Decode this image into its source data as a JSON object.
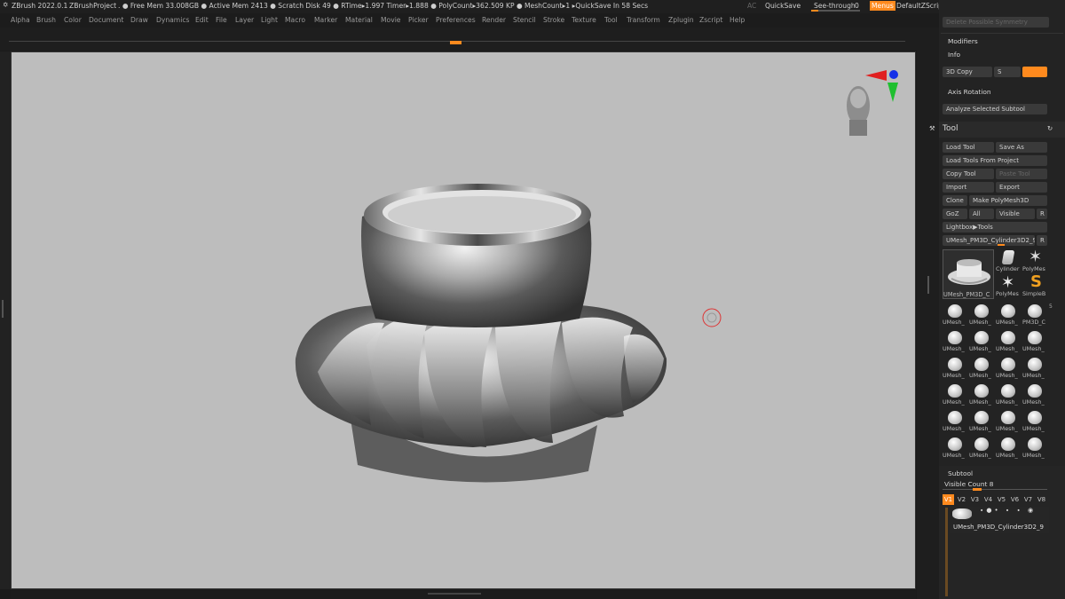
{
  "titlebar": {
    "app": "ZBrush 2022.0.1",
    "project": "ZBrushProject",
    "status": ". ● Free Mem 33.008GB ● Active Mem 2413 ● Scratch Disk 49 ●  RTime▸1.997 Timer▸1.888 ● PolyCount▸362.509 KP  ● MeshCount▸1  ▸QuickSave In 58 Secs",
    "ac": "AC",
    "quicksave": "QuickSave",
    "seethrough": "See-through",
    "seethrough_value": "0",
    "menus": "Menus",
    "script": "DefaultZScript"
  },
  "menubar": [
    "Alpha",
    "Brush",
    "Color",
    "Document",
    "Draw",
    "Dynamics",
    "Edit",
    "File",
    "Layer",
    "Light",
    "Macro",
    "Marker",
    "Material",
    "Movie",
    "Picker",
    "Preferences",
    "Render",
    "Stencil",
    "Stroke",
    "Texture",
    "Tool",
    "Transform",
    "Zplugin",
    "Zscript",
    "Help"
  ],
  "panel": {
    "delete_possible_symmetry": "Delete Possible Symmetry",
    "modifiers": "Modifiers",
    "info": "Info",
    "copy3d": "3D Copy",
    "copy3d_s": "S",
    "axis_rotation": "Axis Rotation",
    "analyze": "Analyze Selected Subtool",
    "tool_title": "Tool",
    "load_tool": "Load Tool",
    "save_as": "Save As",
    "load_from_project": "Load Tools From Project",
    "copy_tool": "Copy Tool",
    "paste_tool": "Paste Tool",
    "import": "Import",
    "export": "Export",
    "clone": "Clone",
    "make_polymesh": "Make PolyMesh3D",
    "goz": "GoZ",
    "all": "All",
    "visible": "Visible",
    "r": "R",
    "lightbox": "Lightbox▶Tools",
    "current_tool": "UMesh_PM3D_Cylinder3D2_9",
    "current_tool_r": "R",
    "big_thumb_label": "UMesh_PM3D_C",
    "side_thumbs": [
      "Cylinder",
      "PolyMes",
      "PolyMes",
      "SimpleB"
    ],
    "side_num": "5",
    "grid_labels": [
      [
        "UMesh_",
        "UMesh_",
        "UMesh_",
        "PM3D_C"
      ],
      [
        "UMesh_",
        "UMesh_",
        "UMesh_",
        "UMesh_"
      ],
      [
        "UMesh_",
        "UMesh_",
        "UMesh_",
        "UMesh_"
      ],
      [
        "UMesh_",
        "UMesh_",
        "UMesh_",
        "UMesh_"
      ],
      [
        "UMesh_",
        "UMesh_",
        "UMesh_",
        "UMesh_"
      ],
      [
        "UMesh_",
        "UMesh_",
        "UMesh_",
        "UMesh_"
      ]
    ],
    "subtool_title": "Subtool",
    "visible_count": "Visible Count 8",
    "vtabs": [
      "V1",
      "V2",
      "V3",
      "V4",
      "V5",
      "V6",
      "V7",
      "V8"
    ],
    "subtool_item": "UMesh_PM3D_Cylinder3D2_9"
  },
  "colors": {
    "accent": "#ff8a1e",
    "canvas": "#bdbdbd",
    "gizmo_x": "#e02020",
    "gizmo_y": "#1fbf2f",
    "gizmo_z": "#1530e8"
  }
}
